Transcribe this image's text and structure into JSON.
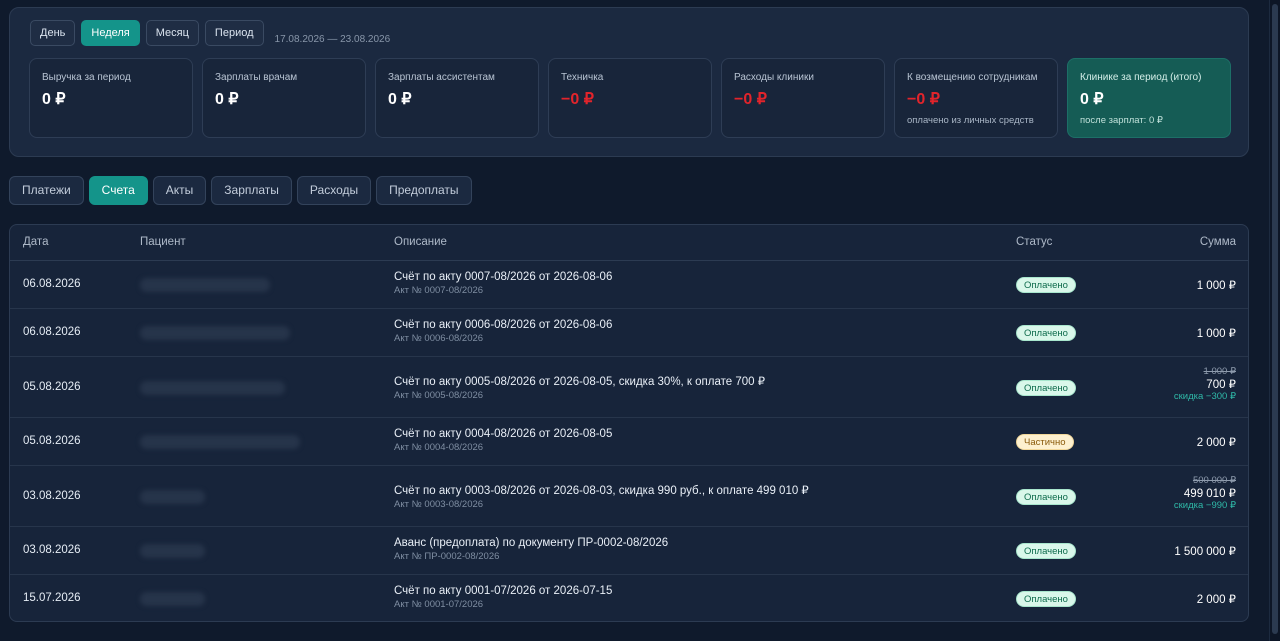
{
  "period": {
    "buttons": [
      {
        "label": "День",
        "active": false
      },
      {
        "label": "Неделя",
        "active": true
      },
      {
        "label": "Месяц",
        "active": false
      },
      {
        "label": "Период",
        "active": false
      }
    ],
    "range": "17.08.2026 — 23.08.2026"
  },
  "cards": [
    {
      "label": "Выручка за период",
      "value": "0 ₽",
      "negative": false,
      "note": ""
    },
    {
      "label": "Зарплаты врачам",
      "value": "0 ₽",
      "negative": false,
      "note": ""
    },
    {
      "label": "Зарплаты ассистентам",
      "value": "0 ₽",
      "negative": false,
      "note": ""
    },
    {
      "label": "Техничка",
      "value": "−0 ₽",
      "negative": true,
      "note": ""
    },
    {
      "label": "Расходы клиники",
      "value": "−0 ₽",
      "negative": true,
      "note": ""
    },
    {
      "label": "К возмещению сотрудникам",
      "value": "−0 ₽",
      "negative": true,
      "note": "оплачено из личных средств"
    },
    {
      "label": "Клинике за период (итого)",
      "value": "0 ₽",
      "negative": false,
      "note": "после зарплат: 0 ₽",
      "total": true
    }
  ],
  "tabs": [
    {
      "label": "Платежи",
      "active": false
    },
    {
      "label": "Счета",
      "active": true
    },
    {
      "label": "Акты",
      "active": false
    },
    {
      "label": "Зарплаты",
      "active": false
    },
    {
      "label": "Расходы",
      "active": false
    },
    {
      "label": "Предоплаты",
      "active": false
    }
  ],
  "table": {
    "headers": {
      "date": "Дата",
      "patient": "Пациент",
      "description": "Описание",
      "status": "Статус",
      "sum": "Сумма"
    },
    "rows": [
      {
        "date": "06.08.2026",
        "description": "Счёт по акту 0007-08/2026 от 2026-08-06",
        "sub": "Акт № 0007-08/2026",
        "status": "Оплачено",
        "status_kind": "paid",
        "sum": "1 000 ₽",
        "sum_old": "",
        "discount": ""
      },
      {
        "date": "06.08.2026",
        "description": "Счёт по акту 0006-08/2026 от 2026-08-06",
        "sub": "Акт № 0006-08/2026",
        "status": "Оплачено",
        "status_kind": "paid",
        "sum": "1 000 ₽",
        "sum_old": "",
        "discount": ""
      },
      {
        "date": "05.08.2026",
        "description": "Счёт по акту 0005-08/2026 от 2026-08-05, скидка 30%, к оплате 700 ₽",
        "sub": "Акт № 0005-08/2026",
        "status": "Оплачено",
        "status_kind": "paid",
        "sum": "700 ₽",
        "sum_old": "1 000 ₽",
        "discount": "скидка −300 ₽"
      },
      {
        "date": "05.08.2026",
        "description": "Счёт по акту 0004-08/2026 от 2026-08-05",
        "sub": "Акт № 0004-08/2026",
        "status": "Частично",
        "status_kind": "partial",
        "sum": "2 000 ₽",
        "sum_old": "",
        "discount": ""
      },
      {
        "date": "03.08.2026",
        "description": "Счёт по акту 0003-08/2026 от 2026-08-03, скидка 990 руб., к оплате 499 010 ₽",
        "sub": "Акт № 0003-08/2026",
        "status": "Оплачено",
        "status_kind": "paid",
        "sum": "499 010 ₽",
        "sum_old": "500 000 ₽",
        "discount": "скидка −990 ₽"
      },
      {
        "date": "03.08.2026",
        "description": "Аванс (предоплата) по документу ПР-0002-08/2026",
        "sub": "Акт № ПР-0002-08/2026",
        "status": "Оплачено",
        "status_kind": "paid",
        "sum": "1 500 000 ₽",
        "sum_old": "",
        "discount": ""
      },
      {
        "date": "15.07.2026",
        "description": "Счёт по акту 0001-07/2026 от 2026-07-15",
        "sub": "Акт № 0001-07/2026",
        "status": "Оплачено",
        "status_kind": "paid",
        "sum": "2 000 ₽",
        "sum_old": "",
        "discount": ""
      }
    ]
  }
}
